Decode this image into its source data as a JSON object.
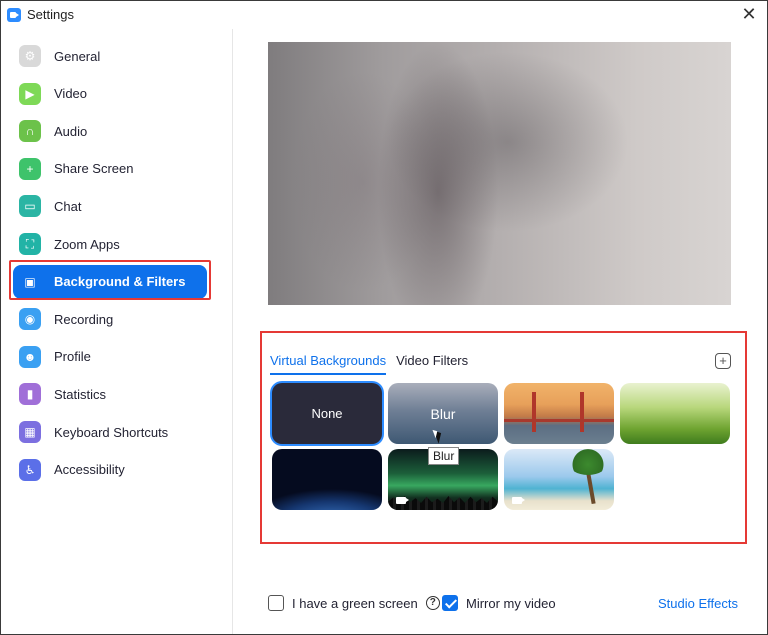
{
  "window": {
    "title": "Settings",
    "close_glyph": "✕"
  },
  "sidebar": {
    "items": [
      {
        "label": "General",
        "icon": "gear-icon",
        "glyph": "⚙",
        "color": "#d9d9d9"
      },
      {
        "label": "Video",
        "icon": "video-icon",
        "glyph": "▶",
        "color": "#7ed957"
      },
      {
        "label": "Audio",
        "icon": "headphones-icon",
        "glyph": "∩",
        "color": "#6cc24a"
      },
      {
        "label": "Share Screen",
        "icon": "share-screen-icon",
        "glyph": "+",
        "color": "#3ec36b"
      },
      {
        "label": "Chat",
        "icon": "chat-icon",
        "glyph": "▭",
        "color": "#2bb5a4"
      },
      {
        "label": "Zoom Apps",
        "icon": "zoom-apps-icon",
        "glyph": "⛶",
        "color": "#22b3a6"
      },
      {
        "label": "Background & Filters",
        "icon": "background-icon",
        "glyph": "▣",
        "color": "#0E71EB",
        "active": true
      },
      {
        "label": "Recording",
        "icon": "recording-icon",
        "glyph": "◉",
        "color": "#3aa0f2"
      },
      {
        "label": "Profile",
        "icon": "profile-icon",
        "glyph": "☻",
        "color": "#3aa0f2"
      },
      {
        "label": "Statistics",
        "icon": "statistics-icon",
        "glyph": "▮",
        "color": "#a06fd8"
      },
      {
        "label": "Keyboard Shortcuts",
        "icon": "keyboard-icon",
        "glyph": "▦",
        "color": "#7c6fe0"
      },
      {
        "label": "Accessibility",
        "icon": "accessibility-icon",
        "glyph": "♿",
        "color": "#5b6fe8"
      }
    ]
  },
  "tabs": [
    {
      "label": "Virtual Backgrounds",
      "active": true
    },
    {
      "label": "Video Filters",
      "active": false
    }
  ],
  "add_glyph": "+",
  "backgrounds": [
    {
      "label": "None",
      "kind": "none",
      "selected": true
    },
    {
      "label": "Blur",
      "kind": "blur"
    },
    {
      "label": "",
      "kind": "bridge"
    },
    {
      "label": "",
      "kind": "grass"
    },
    {
      "label": "",
      "kind": "earth"
    },
    {
      "label": "",
      "kind": "aurora",
      "video": true
    },
    {
      "label": "",
      "kind": "beach",
      "video": true
    }
  ],
  "tooltip": "Blur",
  "footer": {
    "green_screen_label": "I have a green screen",
    "green_screen_checked": false,
    "help_glyph": "?",
    "mirror_label": "Mirror my video",
    "mirror_checked": true,
    "studio_effects": "Studio Effects"
  },
  "colors": {
    "accent": "#0E71EB",
    "highlight": "#e53935"
  }
}
